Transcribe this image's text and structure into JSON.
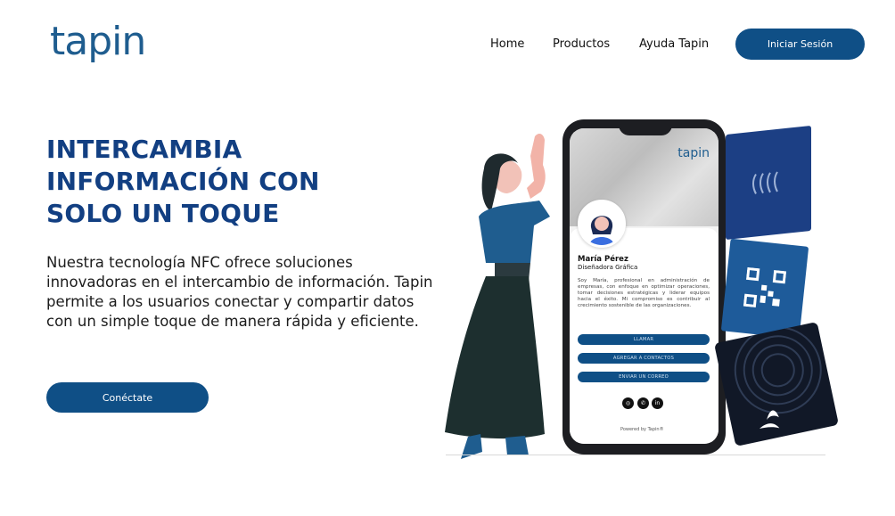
{
  "brand": {
    "logo": "tapin",
    "color": "#1f5d8f"
  },
  "nav": {
    "home": "Home",
    "products": "Productos",
    "help": "Ayuda Tapin",
    "login": "Iniciar Sesión"
  },
  "hero": {
    "headline": [
      "INTERCAMBIA",
      "INFORMACIÓN CON",
      "SOLO UN TOQUE"
    ],
    "description": "Nuestra tecnología NFC ofrece soluciones innovadoras en el intercambio de información. Tapin permite a los usuarios conectar y compartir datos con un simple toque de manera rápida y eficiente.",
    "cta": "Conéctate"
  },
  "profile": {
    "brand": "tapin",
    "name": "María Pérez",
    "role": "Diseñadora Gráfica",
    "bio": "Soy María, profesional en administración de empresas, con enfoque en optimizar operaciones, tomar decisiones estratégicas y liderar equipos hacia el éxito. Mi compromiso es contribuir al crecimiento sostenible de las organizaciones.",
    "buttons": [
      "LLAMAR",
      "AGREGAR A CONTACTOS",
      "ENVIAR UN CORREO"
    ],
    "social": [
      "instagram-icon",
      "whatsapp-icon",
      "linkedin-icon"
    ],
    "powered": "Powered by Tapin®"
  },
  "colors": {
    "primary": "#0f4f86",
    "headline": "#123f82"
  }
}
